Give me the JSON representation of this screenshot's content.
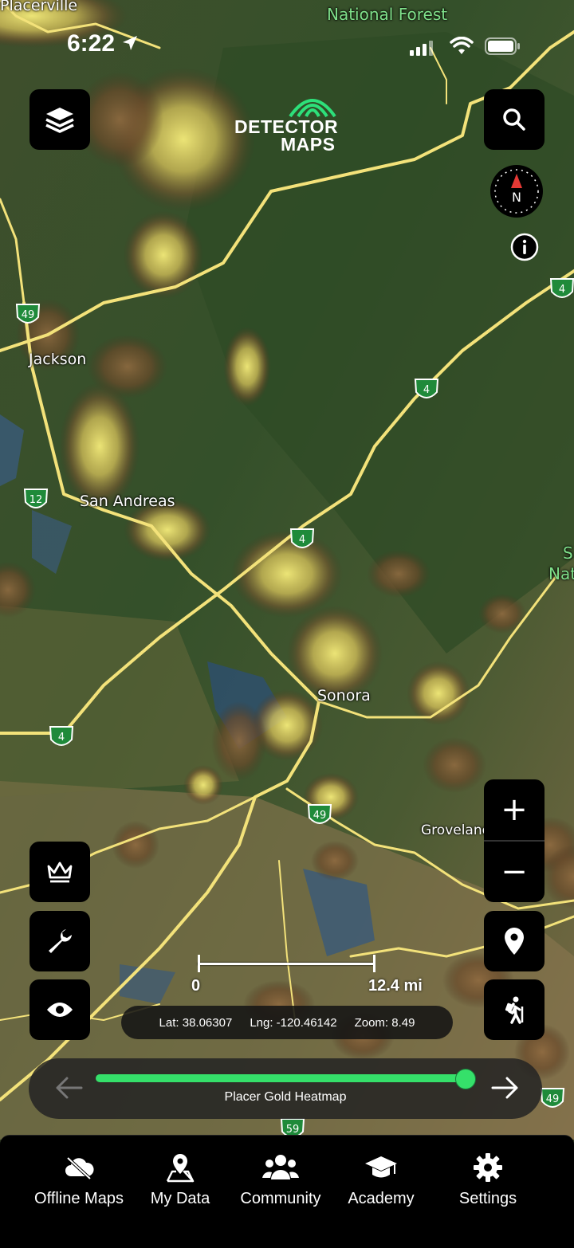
{
  "status_bar": {
    "time": "6:22"
  },
  "app": {
    "logo_line1": "DETECTOR",
    "logo_line2": "MAPS"
  },
  "map": {
    "places": {
      "placerville": "Placerville",
      "national_forest": "National Forest",
      "jackson": "Jackson",
      "san_andreas": "San Andreas",
      "sonora": "Sonora",
      "groveland": "Groveland",
      "nat_edge": "Nat",
      "s_edge": "S"
    },
    "shields": {
      "hwy49_a": "49",
      "hwy4_a": "4",
      "hwy4_b": "4",
      "hwy12": "12",
      "hwy4_c": "4",
      "hwy4_d": "4",
      "hwy49_b": "49",
      "hwy49_c": "49",
      "hwy59": "59"
    },
    "compass_letter": "N"
  },
  "scale": {
    "left": "0",
    "right": "12.4 mi"
  },
  "coords": {
    "lat": "Lat: 38.06307",
    "lng": "Lng: -120.46142",
    "zoom": "Zoom: 8.49"
  },
  "timeline": {
    "caption": "Placer Gold Heatmap",
    "progress": 1.0
  },
  "zoom": {
    "plus": "+",
    "minus": "−"
  },
  "tabs": [
    {
      "label": "Offline Maps",
      "icon": "cloud-off-icon"
    },
    {
      "label": "My Data",
      "icon": "map-pin-icon"
    },
    {
      "label": "Community",
      "icon": "users-icon"
    },
    {
      "label": "Academy",
      "icon": "graduation-cap-icon"
    },
    {
      "label": "Settings",
      "icon": "gear-icon"
    }
  ],
  "colors": {
    "accent": "#35e06a",
    "highway": "#f3e27a",
    "heat": "#f2e36a",
    "button_bg": "#000000"
  }
}
